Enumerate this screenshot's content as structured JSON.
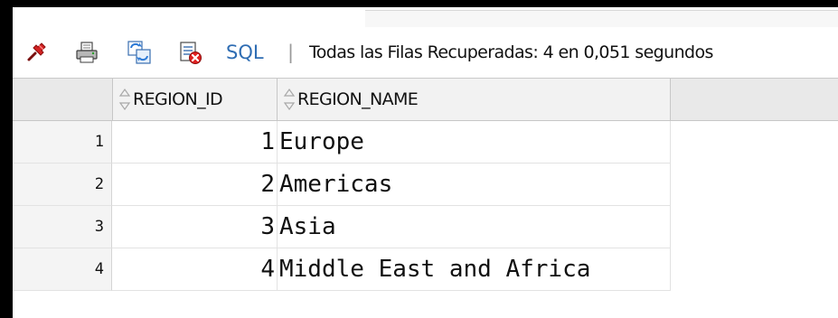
{
  "toolbar": {
    "icons": [
      "pin-icon",
      "print-icon",
      "refresh-sql-icon",
      "cancel-fetch-icon"
    ],
    "sql_label": "SQL",
    "separator": "|",
    "status_text": "Todas las Filas Recuperadas: 4 en 0,051 segundos"
  },
  "grid": {
    "columns": [
      {
        "label": "REGION_ID"
      },
      {
        "label": "REGION_NAME"
      }
    ],
    "rows": [
      {
        "num": "1",
        "region_id": "1",
        "region_name": "Europe"
      },
      {
        "num": "2",
        "region_id": "2",
        "region_name": "Americas"
      },
      {
        "num": "3",
        "region_id": "3",
        "region_name": "Asia"
      },
      {
        "num": "4",
        "region_id": "4",
        "region_name": "Middle East and Africa"
      }
    ]
  },
  "colors": {
    "sql_link": "#2f6db3",
    "header_bg": "#e9e9e9",
    "rownum_bg": "#f4f4f4"
  }
}
